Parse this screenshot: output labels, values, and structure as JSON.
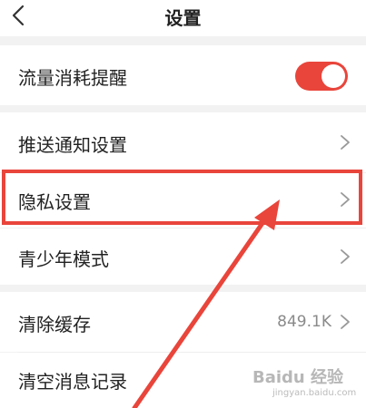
{
  "header": {
    "title": "设置"
  },
  "settings": {
    "data_usage_reminder": {
      "label": "流量消耗提醒",
      "enabled": true
    },
    "push_notifications": {
      "label": "推送通知设置"
    },
    "privacy": {
      "label": "隐私设置"
    },
    "teen_mode": {
      "label": "青少年模式"
    },
    "clear_cache": {
      "label": "清除缓存",
      "value": "849.1K"
    },
    "clear_messages": {
      "label": "清空消息记录"
    }
  },
  "icons": {
    "back": "chevron-left-icon",
    "row_arrow": "chevron-right-icon"
  },
  "colors": {
    "accent": "#e9453b",
    "background": "#f2f2f2"
  },
  "watermark": {
    "text": "Baidu 经验",
    "sub": "jingyan.baidu.com"
  }
}
